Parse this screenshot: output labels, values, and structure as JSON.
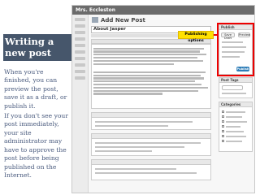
{
  "slide": {
    "title": "Writing a new post",
    "paragraph1": "When you're finished, you can preview the post, save it as a draft, or publish it.",
    "paragraph2": "If you don't see your post immediately, your site administrator may have to approve the post before being published on the Internet."
  },
  "screenshot": {
    "site_name": "Mrs. Eccleston",
    "page_heading": "Add New Post",
    "post_title": "About Jasper",
    "callout": "Publishing options",
    "publish_panel": {
      "heading": "Publish",
      "save_draft": "Save Draft",
      "preview": "Preview",
      "publish": "Publish"
    },
    "tags_heading": "Post Tags",
    "categories_heading": "Categories",
    "colors": {
      "callout_bg": "#ffe100",
      "highlight_border": "#e00000",
      "publish_button": "#2e7eb8",
      "title_band": "#46566b"
    }
  }
}
